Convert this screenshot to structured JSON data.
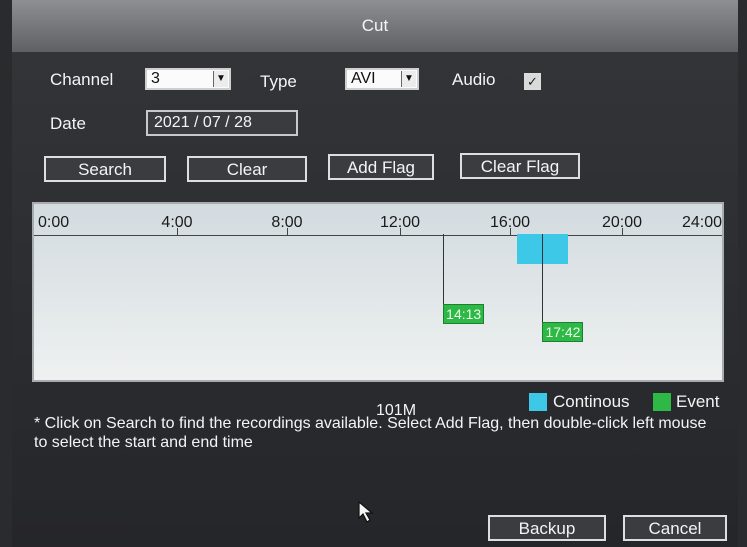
{
  "window": {
    "title": "Cut"
  },
  "channel": {
    "label": "Channel",
    "value": "3"
  },
  "type": {
    "label": "Type",
    "value": "AVI"
  },
  "audio": {
    "label": "Audio",
    "checked": true
  },
  "date": {
    "label": "Date",
    "value": "2021 / 07 / 28"
  },
  "buttons": {
    "search": "Search",
    "clear": "Clear",
    "add_flag": "Add Flag",
    "clear_flag": "Clear Flag",
    "backup": "Backup",
    "cancel": "Cancel"
  },
  "timeline": {
    "ticks": [
      "0:00",
      "4:00",
      "8:00",
      "12:00",
      "16:00",
      "20:00",
      "24:00"
    ],
    "continuous_segment": {
      "start": "16:48",
      "end": "18:36"
    },
    "flags": [
      {
        "time": "14:13",
        "label": "14:13"
      },
      {
        "time": "17:42",
        "label": "17:42"
      }
    ]
  },
  "legend": {
    "continuous": {
      "label": "Continous",
      "color": "#3cc8e6"
    },
    "event": {
      "label": "Event",
      "color": "#2eb845"
    }
  },
  "size": "101M",
  "hint_text": "* Click on Search to find the recordings available. Select Add Flag, then double-click left mouse to select the start and end time"
}
